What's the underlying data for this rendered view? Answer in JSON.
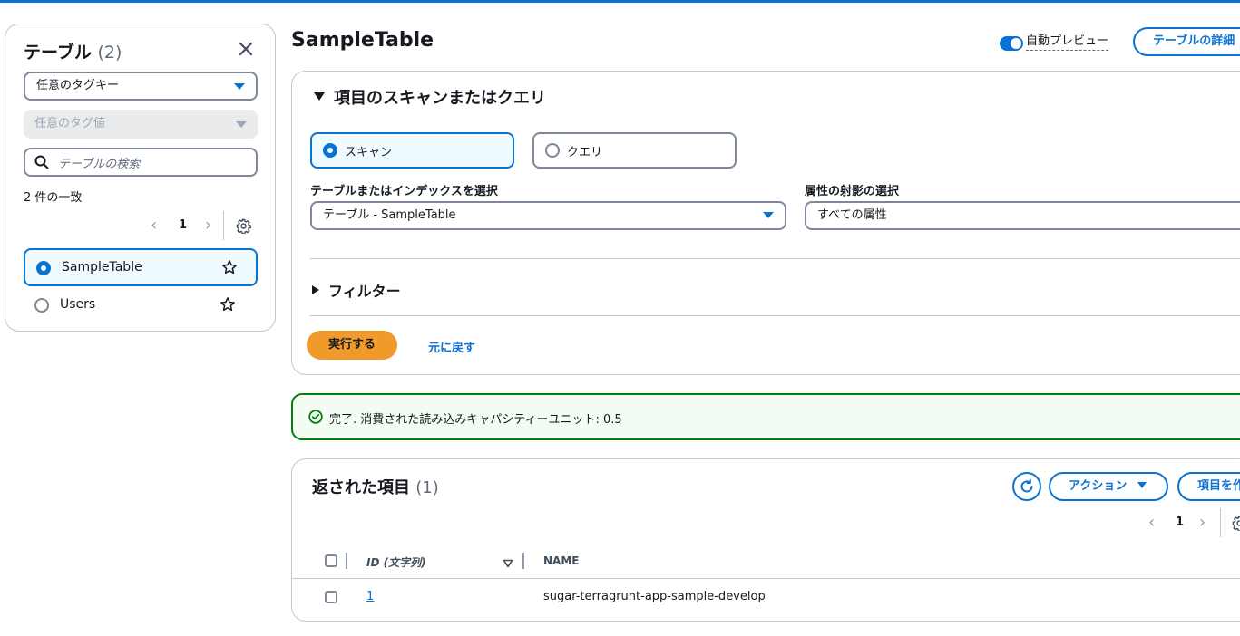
{
  "sidebar": {
    "title": "テーブル",
    "count": "(2)",
    "tag_key_select": "任意のタグキー",
    "tag_value_select": "任意のタグ値",
    "search_placeholder": "テーブルの検索",
    "match_text": "2 件の一致",
    "page": "1",
    "tables": [
      {
        "label": "SampleTable",
        "selected": true
      },
      {
        "label": "Users",
        "selected": false
      }
    ]
  },
  "header": {
    "title": "SampleTable",
    "auto_preview_label": "自動プレビュー",
    "auto_preview_on": true,
    "details_button": "テーブルの詳細"
  },
  "scan": {
    "section_title": "項目のスキャンまたはクエリ",
    "mode_scan": "スキャン",
    "mode_query": "クエリ",
    "selected_mode": "スキャン",
    "index_label": "テーブルまたはインデックスを選択",
    "index_value": "テーブル - SampleTable",
    "projection_label": "属性の射影の選択",
    "projection_value": "すべての属性",
    "filter_label": "フィルター",
    "run_button": "実行する",
    "reset_button": "元に戻す"
  },
  "alert": {
    "message": "完了. 消費された読み込みキャパシティーユニット: 0.5",
    "type": "success"
  },
  "results": {
    "title": "返された項目",
    "count": "(1)",
    "actions_button": "アクション",
    "create_button": "項目を作",
    "page": "1",
    "columns": [
      "ID (文字列)",
      "NAME"
    ],
    "rows": [
      {
        "id": "1",
        "name": "sugar-terragrunt-app-sample-develop"
      }
    ]
  },
  "colors": {
    "accent": "#0972d3",
    "primary_button": "#f19a2c",
    "success": "#037f0c"
  }
}
